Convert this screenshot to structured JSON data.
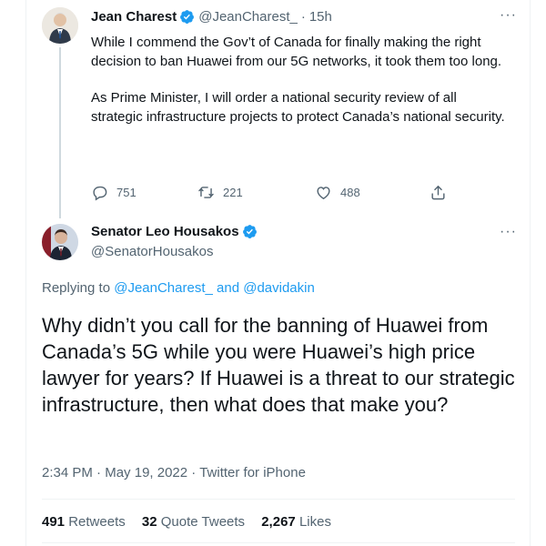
{
  "tweet1": {
    "name": "Jean Charest",
    "handle": "@JeanCharest_",
    "sep": "·",
    "time": "15h",
    "more": "···",
    "paragraph1": "While I commend the Gov’t of Canada for finally making the right decision to ban Huawei from our 5G networks, it took them too long.",
    "paragraph2": "As Prime Minister, I will order a national security review of all strategic infrastructure projects to protect Canada’s national security.",
    "replies": "751",
    "retweets": "221",
    "likes": "488"
  },
  "tweet2": {
    "name": "Senator Leo Housakos",
    "handle": "@SenatorHousakos",
    "more": "···",
    "replying_prefix": "Replying to",
    "reply_user1": "@JeanCharest_",
    "reply_and": "and",
    "reply_user2": "@davidakin",
    "body": "Why didn’t you call for the banning of Huawei from Canada’s 5G while you were Huawei’s high price lawyer for years? If Huawei is a threat to our strategic infrastructure, then what does that make you?",
    "time": "2:34 PM",
    "date": "May 19, 2022",
    "source": "Twitter for iPhone",
    "dot": "·",
    "retweets_count": "491",
    "retweets_label": "Retweets",
    "quotes_count": "32",
    "quotes_label": "Quote Tweets",
    "likes_count": "2,267",
    "likes_label": "Likes"
  },
  "colors": {
    "accent": "#1d9bf0",
    "muted": "#536471",
    "text": "#0f1419"
  },
  "icons": [
    "verified-badge-icon",
    "reply-icon",
    "retweet-icon",
    "like-icon",
    "share-icon",
    "more-icon"
  ]
}
